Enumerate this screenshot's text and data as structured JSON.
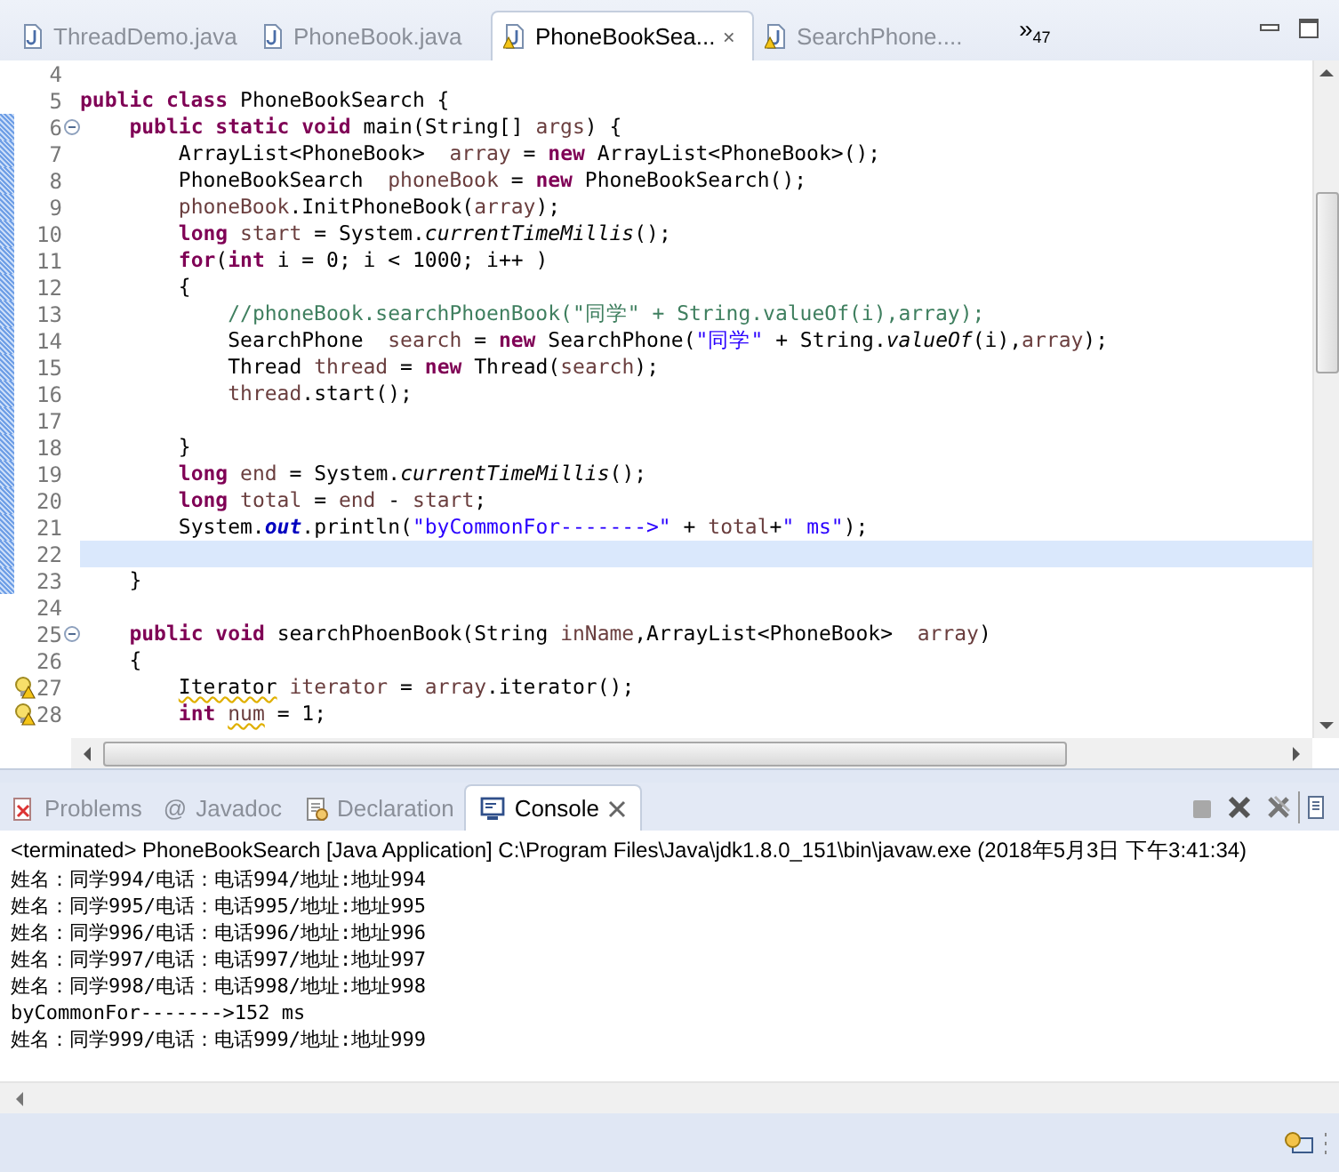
{
  "editor_tabs": [
    {
      "label": "ThreadDemo.java",
      "selected": false,
      "warning": false
    },
    {
      "label": "PhoneBook.java",
      "selected": false,
      "warning": false
    },
    {
      "label": "PhoneBookSea...",
      "selected": true,
      "warning": true
    },
    {
      "label": "SearchPhone....",
      "selected": false,
      "warning": true
    }
  ],
  "hidden_tabs": {
    "marker": "»",
    "count": "47"
  },
  "editor": {
    "lines": [
      {
        "number": "4",
        "kind": "code",
        "changed": false,
        "current": false
      },
      {
        "number": "5",
        "kind": "code",
        "changed": false,
        "current": false,
        "tokens": [
          {
            "kind": "kw",
            "text": "public class"
          },
          {
            "kind": "plain",
            "text": " PhoneBookSearch {"
          }
        ]
      },
      {
        "number": "6",
        "kind": "fold",
        "changed": true,
        "current": false,
        "tokens": [
          {
            "kind": "kw",
            "text": "    public static void"
          },
          {
            "kind": "plain",
            "text": " main(String[] "
          },
          {
            "kind": "var",
            "text": "args"
          },
          {
            "kind": "plain",
            "text": ") {"
          }
        ]
      },
      {
        "number": "7",
        "kind": "code",
        "changed": true,
        "current": false,
        "tokens": [
          {
            "kind": "plain",
            "text": "        ArrayList<PhoneBook>  "
          },
          {
            "kind": "var",
            "text": "array"
          },
          {
            "kind": "plain",
            "text": " = "
          },
          {
            "kind": "kw",
            "text": "new"
          },
          {
            "kind": "plain",
            "text": " ArrayList<PhoneBook>();"
          }
        ]
      },
      {
        "number": "8",
        "kind": "code",
        "changed": true,
        "current": false,
        "tokens": [
          {
            "kind": "plain",
            "text": "        PhoneBookSearch  "
          },
          {
            "kind": "var",
            "text": "phoneBook"
          },
          {
            "kind": "plain",
            "text": " = "
          },
          {
            "kind": "kw",
            "text": "new"
          },
          {
            "kind": "plain",
            "text": " PhoneBookSearch();"
          }
        ]
      },
      {
        "number": "9",
        "kind": "code",
        "changed": true,
        "current": false,
        "tokens": [
          {
            "kind": "var",
            "text": "        phoneBook"
          },
          {
            "kind": "plain",
            "text": ".InitPhoneBook("
          },
          {
            "kind": "var",
            "text": "array"
          },
          {
            "kind": "plain",
            "text": ");"
          }
        ]
      },
      {
        "number": "10",
        "kind": "code",
        "changed": true,
        "current": false,
        "tokens": [
          {
            "kind": "kw",
            "text": "        long"
          },
          {
            "kind": "var",
            "text": " start"
          },
          {
            "kind": "plain",
            "text": " = System."
          },
          {
            "kind": "static",
            "text": "currentTimeMillis"
          },
          {
            "kind": "plain",
            "text": "();"
          }
        ]
      },
      {
        "number": "11",
        "kind": "code",
        "changed": true,
        "current": false,
        "tokens": [
          {
            "kind": "kw",
            "text": "        for"
          },
          {
            "kind": "plain",
            "text": "("
          },
          {
            "kind": "kw",
            "text": "int"
          },
          {
            "kind": "plain",
            "text": " i = 0; i < 1000; i++ )"
          }
        ]
      },
      {
        "number": "12",
        "kind": "code",
        "changed": true,
        "current": false,
        "tokens": [
          {
            "kind": "plain",
            "text": "        {"
          }
        ]
      },
      {
        "number": "13",
        "kind": "code",
        "changed": true,
        "current": false,
        "tokens": [
          {
            "kind": "comment",
            "text": "            //phoneBook.searchPhoenBook(\"同学\" + String.valueOf(i),array);"
          }
        ]
      },
      {
        "number": "14",
        "kind": "code",
        "changed": true,
        "current": false,
        "tokens": [
          {
            "kind": "plain",
            "text": "            SearchPhone  "
          },
          {
            "kind": "var",
            "text": "search"
          },
          {
            "kind": "plain",
            "text": " = "
          },
          {
            "kind": "kw",
            "text": "new"
          },
          {
            "kind": "plain",
            "text": " SearchPhone("
          },
          {
            "kind": "str",
            "text": "\"同学\""
          },
          {
            "kind": "plain",
            "text": " + String."
          },
          {
            "kind": "static",
            "text": "valueOf"
          },
          {
            "kind": "plain",
            "text": "(i),"
          },
          {
            "kind": "var",
            "text": "array"
          },
          {
            "kind": "plain",
            "text": ");"
          }
        ]
      },
      {
        "number": "15",
        "kind": "code",
        "changed": true,
        "current": false,
        "tokens": [
          {
            "kind": "plain",
            "text": "            Thread "
          },
          {
            "kind": "var",
            "text": "thread"
          },
          {
            "kind": "plain",
            "text": " = "
          },
          {
            "kind": "kw",
            "text": "new"
          },
          {
            "kind": "plain",
            "text": " Thread("
          },
          {
            "kind": "var",
            "text": "search"
          },
          {
            "kind": "plain",
            "text": ");"
          }
        ]
      },
      {
        "number": "16",
        "kind": "code",
        "changed": true,
        "current": false,
        "tokens": [
          {
            "kind": "var",
            "text": "            thread"
          },
          {
            "kind": "plain",
            "text": ".start();"
          }
        ]
      },
      {
        "number": "17",
        "kind": "code",
        "changed": true,
        "current": false
      },
      {
        "number": "18",
        "kind": "code",
        "changed": true,
        "current": false,
        "tokens": [
          {
            "kind": "plain",
            "text": "        }"
          }
        ]
      },
      {
        "number": "19",
        "kind": "code",
        "changed": true,
        "current": false,
        "tokens": [
          {
            "kind": "kw",
            "text": "        long"
          },
          {
            "kind": "var",
            "text": " end"
          },
          {
            "kind": "plain",
            "text": " = System."
          },
          {
            "kind": "static",
            "text": "currentTimeMillis"
          },
          {
            "kind": "plain",
            "text": "();"
          }
        ]
      },
      {
        "number": "20",
        "kind": "code",
        "changed": true,
        "current": false,
        "tokens": [
          {
            "kind": "kw",
            "text": "        long"
          },
          {
            "kind": "var",
            "text": " total"
          },
          {
            "kind": "plain",
            "text": " = "
          },
          {
            "kind": "var",
            "text": "end"
          },
          {
            "kind": "plain",
            "text": " - "
          },
          {
            "kind": "var",
            "text": "start"
          },
          {
            "kind": "plain",
            "text": ";"
          }
        ]
      },
      {
        "number": "21",
        "kind": "code",
        "changed": true,
        "current": false,
        "tokens": [
          {
            "kind": "plain",
            "text": "        System."
          },
          {
            "kind": "field",
            "text": "out"
          },
          {
            "kind": "plain",
            "text": ".println("
          },
          {
            "kind": "str",
            "text": "\"byCommonFor------->\""
          },
          {
            "kind": "plain",
            "text": " + "
          },
          {
            "kind": "var",
            "text": "total"
          },
          {
            "kind": "plain",
            "text": "+"
          },
          {
            "kind": "str",
            "text": "\" ms\""
          },
          {
            "kind": "plain",
            "text": ");"
          }
        ]
      },
      {
        "number": "22",
        "kind": "code",
        "changed": true,
        "current": true
      },
      {
        "number": "23",
        "kind": "code",
        "changed": true,
        "current": false,
        "tokens": [
          {
            "kind": "plain",
            "text": "    }"
          }
        ]
      },
      {
        "number": "24",
        "kind": "code",
        "changed": false,
        "current": false
      },
      {
        "number": "25",
        "kind": "fold",
        "changed": false,
        "current": false,
        "tokens": [
          {
            "kind": "kw",
            "text": "    public void"
          },
          {
            "kind": "plain",
            "text": " searchPhoenBook(String "
          },
          {
            "kind": "var",
            "text": "inName"
          },
          {
            "kind": "plain",
            "text": ",ArrayList<PhoneBook>  "
          },
          {
            "kind": "var",
            "text": "array"
          },
          {
            "kind": "plain",
            "text": ")"
          }
        ]
      },
      {
        "number": "26",
        "kind": "code",
        "changed": false,
        "current": false,
        "tokens": [
          {
            "kind": "plain",
            "text": "    {"
          }
        ]
      },
      {
        "number": "27",
        "kind": "warning",
        "changed": false,
        "current": false,
        "tokens": [
          {
            "kind": "type-warn",
            "text": "        Iterator"
          },
          {
            "kind": "var",
            "text": " iterator"
          },
          {
            "kind": "plain",
            "text": " = "
          },
          {
            "kind": "var",
            "text": "array"
          },
          {
            "kind": "plain",
            "text": ".iterator();"
          }
        ]
      },
      {
        "number": "28",
        "kind": "warning",
        "changed": false,
        "current": false,
        "tokens": [
          {
            "kind": "kw",
            "text": "        int"
          },
          {
            "kind": "var-warn",
            "text": " num"
          },
          {
            "kind": "plain",
            "text": " = 1;"
          }
        ]
      }
    ]
  },
  "view_tabs": [
    {
      "label": "Problems",
      "selected": false
    },
    {
      "label": "Javadoc",
      "glyph": "@",
      "selected": false
    },
    {
      "label": "Declaration",
      "selected": false
    },
    {
      "label": "Console",
      "selected": true
    }
  ],
  "console": {
    "header": "<terminated> PhoneBookSearch [Java Application] C:\\Program Files\\Java\\jdk1.8.0_151\\bin\\javaw.exe (2018年5月3日 下午3:41:34)",
    "lines": [
      "姓名：同学994/电话：电话994/地址:地址994",
      "姓名：同学995/电话：电话995/地址:地址995",
      "姓名：同学996/电话：电话996/地址:地址996",
      "姓名：同学997/电话：电话997/地址:地址997",
      "姓名：同学998/电话：电话998/地址:地址998",
      "byCommonFor------->152 ms",
      "姓名：同学999/电话：电话999/地址:地址999"
    ]
  }
}
